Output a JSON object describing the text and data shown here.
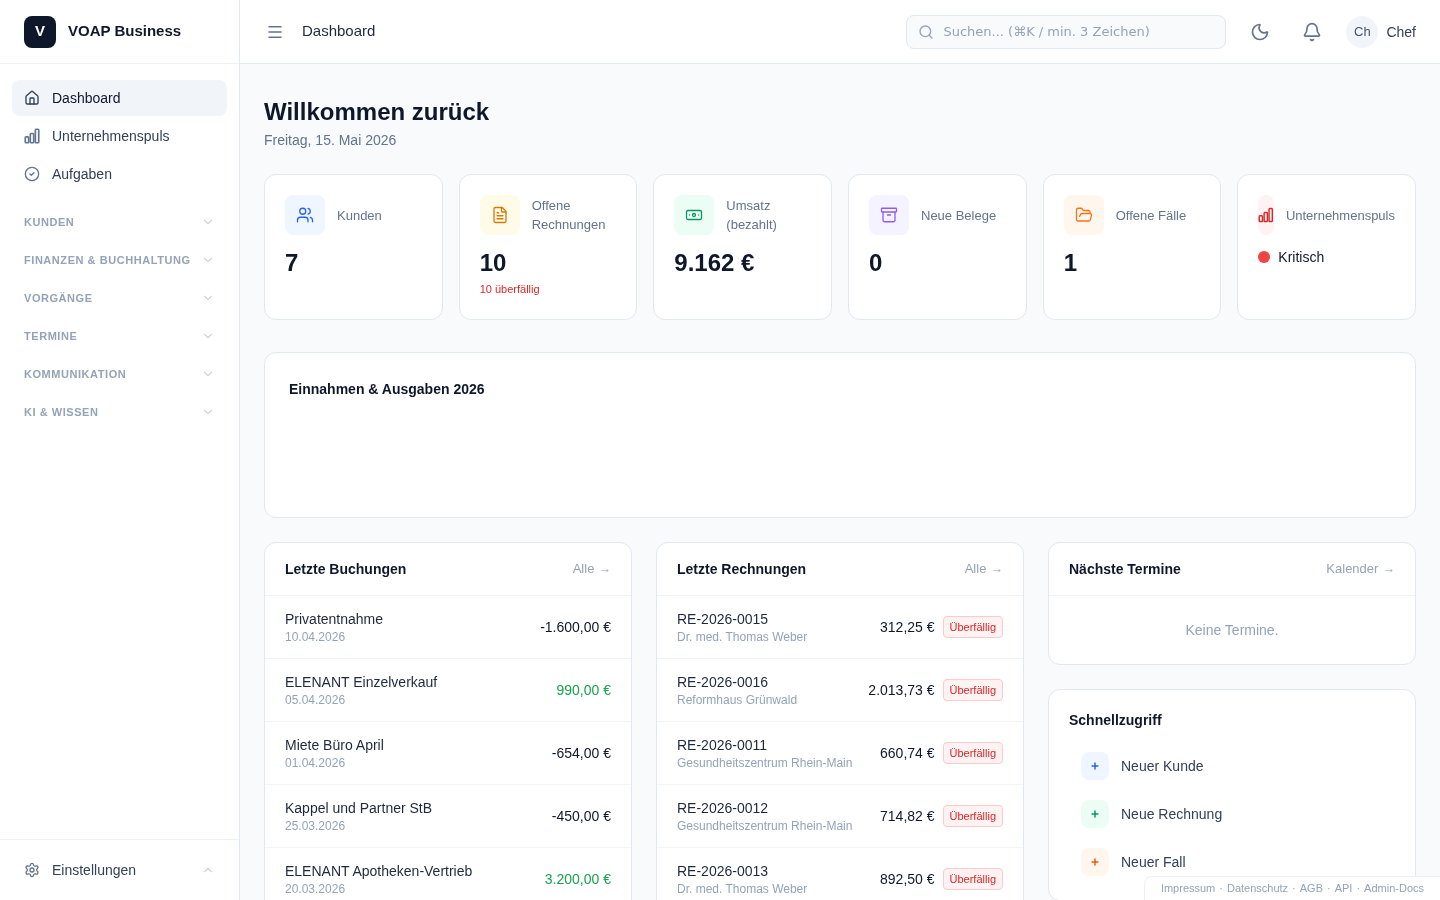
{
  "sidebar": {
    "brand": {
      "logo_letter": "V",
      "name": "VOAP Business"
    },
    "nav": [
      {
        "label": "Dashboard",
        "selected": true
      },
      {
        "label": "Unternehmenspuls",
        "selected": false
      },
      {
        "label": "Aufgaben",
        "selected": false
      }
    ],
    "sections": [
      {
        "label": "KUNDEN",
        "expanded": false
      },
      {
        "label": "FINANZEN & BUCHHALTUNG",
        "expanded": false
      },
      {
        "label": "VORGÄNGE",
        "expanded": false
      },
      {
        "label": "TERMINE",
        "expanded": false
      },
      {
        "label": "KOMMUNIKATION",
        "expanded": false
      },
      {
        "label": "KI & WISSEN",
        "expanded": false
      }
    ],
    "settings": {
      "label": "Einstellungen"
    }
  },
  "header": {
    "title": "Dashboard",
    "search": {
      "placeholder": "Suchen... (⌘K / min. 3 Zeichen)"
    },
    "user": {
      "initials": "Ch",
      "name": "Chef"
    }
  },
  "welcome": {
    "title": "Willkommen zurück",
    "date": "Freitag, 15. Mai 2026"
  },
  "stats": [
    {
      "kind": "value",
      "label": "Kunden",
      "value": "7"
    },
    {
      "kind": "value",
      "label": "Offene Rechnungen",
      "value": "10",
      "note": "10 überfällig"
    },
    {
      "kind": "value",
      "label": "Umsatz (bezahlt)",
      "value": "9.162 €"
    },
    {
      "kind": "value",
      "label": "Neue Belege",
      "value": "0"
    },
    {
      "kind": "value",
      "label": "Offene Fälle",
      "value": "1"
    },
    {
      "kind": "status",
      "label": "Unternehmenspuls",
      "status": {
        "label": "Kritisch",
        "color": "#ef4444"
      }
    }
  ],
  "chart_card": {
    "title": "Einnahmen & Ausgaben 2026"
  },
  "bookings": {
    "title": "Letzte Buchungen",
    "link": "Alle →",
    "rows": [
      {
        "title": "Privatentnahme",
        "date": "10.04.2026",
        "amount": "-1.600,00 €",
        "kind": "expense"
      },
      {
        "title": "ELENANT Einzelverkauf",
        "date": "05.04.2026",
        "amount": "990,00 €",
        "kind": "income"
      },
      {
        "title": "Miete Büro April",
        "date": "01.04.2026",
        "amount": "-654,00 €",
        "kind": "expense"
      },
      {
        "title": "Kappel und Partner StB",
        "date": "25.03.2026",
        "amount": "-450,00 €",
        "kind": "expense"
      },
      {
        "title": "ELENANT Apotheken-Vertrieb",
        "date": "20.03.2026",
        "amount": "3.200,00 €",
        "kind": "income"
      }
    ]
  },
  "invoices": {
    "title": "Letzte Rechnungen",
    "link": "Alle →",
    "rows": [
      {
        "number": "RE-2026-0015",
        "customer": "Dr. med. Thomas Weber",
        "amount": "312,25 €",
        "badge": "Überfällig"
      },
      {
        "number": "RE-2026-0016",
        "customer": "Reformhaus Grünwald",
        "amount": "2.013,73 €",
        "badge": "Überfällig"
      },
      {
        "number": "RE-2026-0011",
        "customer": "Gesundheitszentrum Rhein-Main",
        "amount": "660,74 €",
        "badge": "Überfällig"
      },
      {
        "number": "RE-2026-0012",
        "customer": "Gesundheitszentrum Rhein-Main",
        "amount": "714,82 €",
        "badge": "Überfällig"
      },
      {
        "number": "RE-2026-0013",
        "customer": "Dr. med. Thomas Weber",
        "amount": "892,50 €",
        "badge": "Überfällig"
      }
    ]
  },
  "appointments": {
    "title": "Nächste Termine",
    "link": "Kalender →",
    "empty": "Keine Termine."
  },
  "quick_access": {
    "title": "Schnellzugriff",
    "items": [
      {
        "label": "Neuer Kunde"
      },
      {
        "label": "Neue Rechnung"
      },
      {
        "label": "Neuer Fall"
      }
    ]
  },
  "footer": {
    "links": [
      "Impressum",
      "Datenschutz",
      "AGB",
      "API",
      "Admin-Docs"
    ],
    "separator": "·"
  }
}
